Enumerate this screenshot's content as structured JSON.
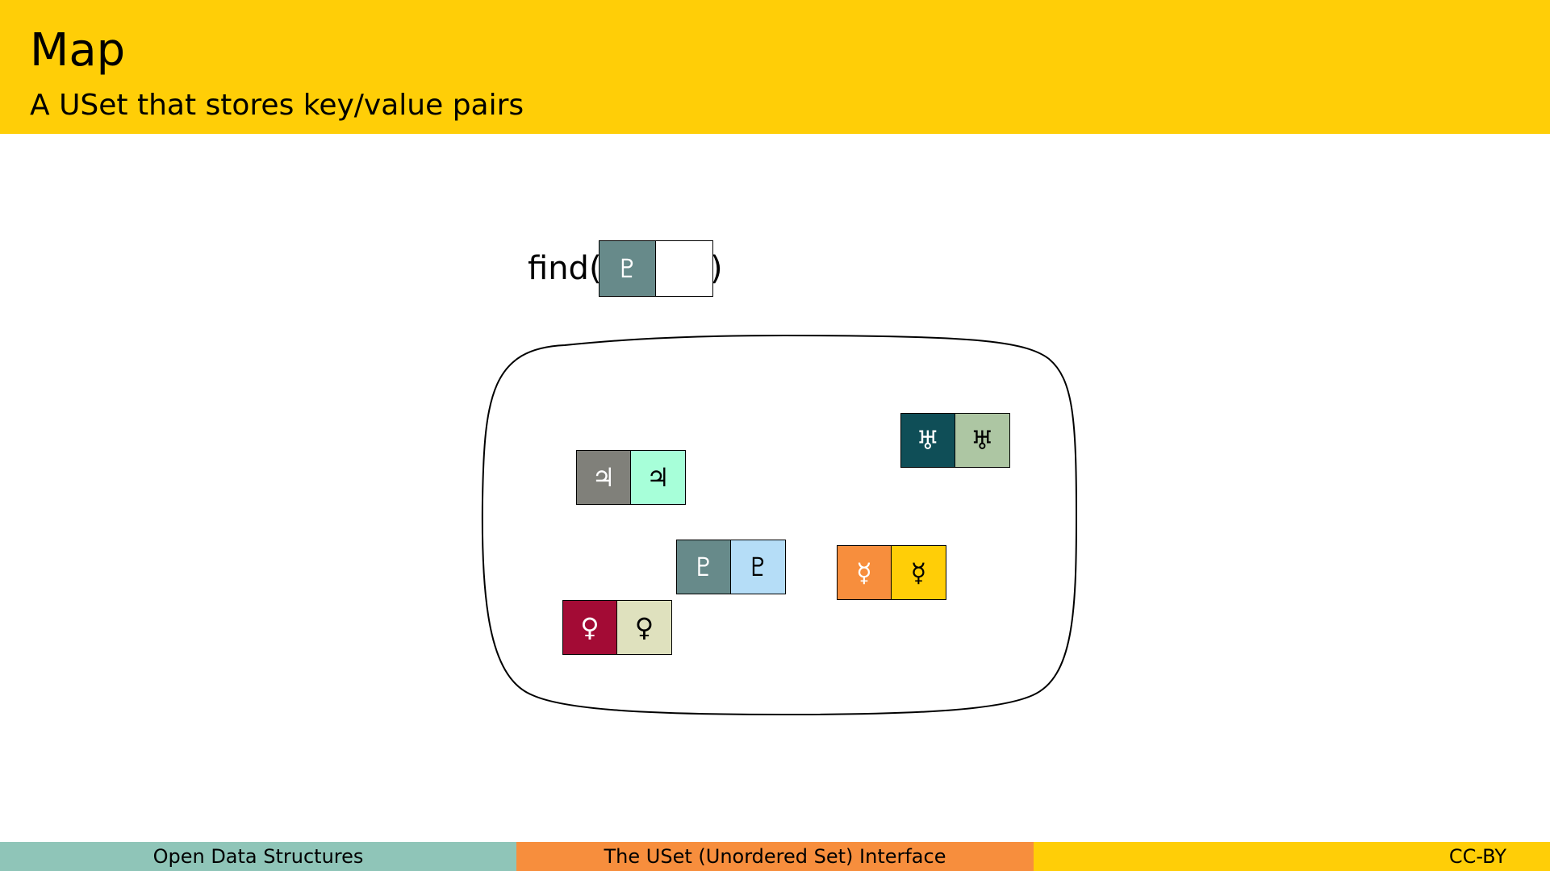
{
  "slide": {
    "title": "Map",
    "subtitle": "A USet that stores key/value pairs"
  },
  "diagram": {
    "find_label": "find(",
    "find_close": ")",
    "query": {
      "key_symbol": "♇",
      "key_color": "#678A8A",
      "value_symbol": "",
      "value_color": "#FFFFFF"
    },
    "pairs": [
      {
        "name": "jupiter",
        "key_symbol": "♃",
        "key_color": "#80807A",
        "value_symbol": "♃",
        "value_color": "#A7FFD9"
      },
      {
        "name": "uranus",
        "key_symbol": "♅",
        "key_color": "#0F4E57",
        "value_symbol": "♅",
        "value_color": "#ADC6A3"
      },
      {
        "name": "pluto",
        "key_symbol": "♇",
        "key_color": "#678A8A",
        "value_symbol": "♇",
        "value_color": "#B5DDF7"
      },
      {
        "name": "mercury",
        "key_symbol": "☿",
        "key_color": "#F78E3D",
        "value_symbol": "☿",
        "value_color": "#FFCE07"
      },
      {
        "name": "venus",
        "key_symbol": "♀",
        "key_color": "#A30B35",
        "value_symbol": "♀",
        "value_color": "#DFE1BE"
      }
    ]
  },
  "footer": {
    "left": "Open Data Structures",
    "center": "The USet (Unordered Set) Interface",
    "right": "CC-BY"
  }
}
